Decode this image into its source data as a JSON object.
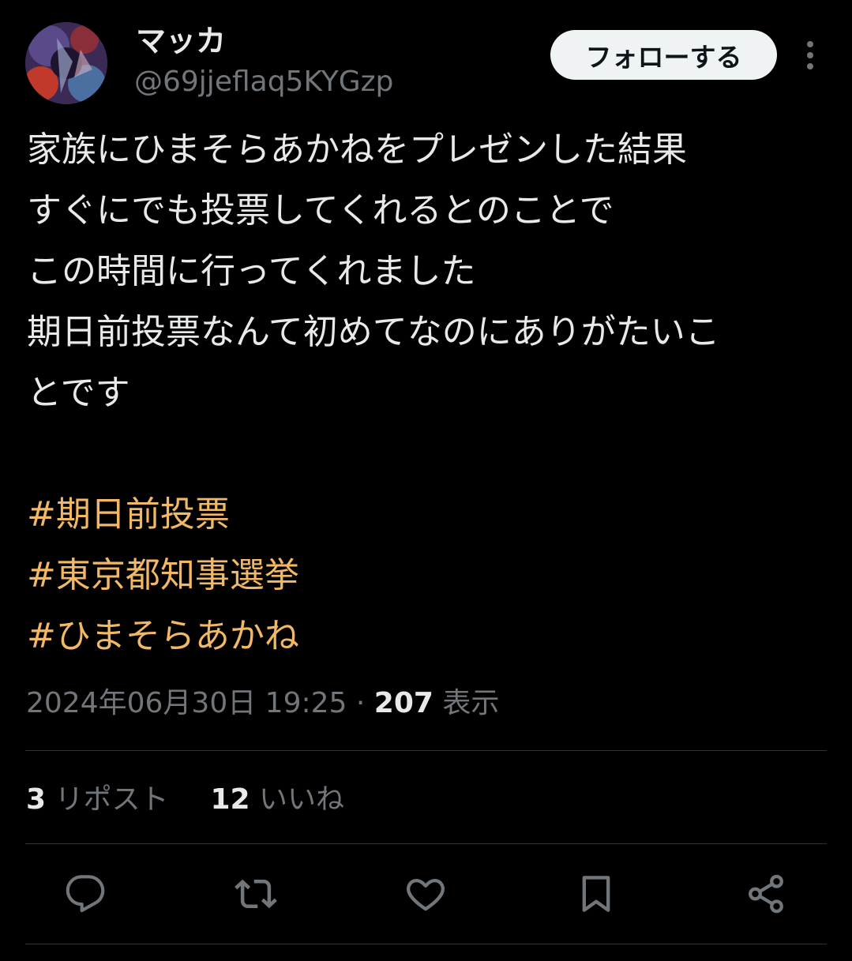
{
  "author": {
    "display_name": "マッカ",
    "handle": "@69jjeflaq5KYGzp"
  },
  "follow_button": {
    "label": "フォローする"
  },
  "more_button": {
    "icon": "more-vertical-icon"
  },
  "tweet": {
    "lines": [
      "家族にひまそらあかねをプレゼンした結果",
      "すぐにでも投票してくれるとのことで",
      "この時間に行ってくれました",
      "期日前投票なんて初めてなのにありがたいこ",
      "とです"
    ],
    "hashtags": [
      "#期日前投票",
      "#東京都知事選挙",
      "#ひまそらあかね"
    ]
  },
  "meta": {
    "timestamp": "2024年06月30日 19:25",
    "separator": " · ",
    "views_count": "207",
    "views_label": "表示"
  },
  "stats": {
    "reposts_count": "3",
    "reposts_label": "リポスト",
    "likes_count": "12",
    "likes_label": "いいね"
  },
  "actions": [
    {
      "name": "reply",
      "icon": "reply-icon"
    },
    {
      "name": "repost",
      "icon": "repost-icon"
    },
    {
      "name": "like",
      "icon": "heart-icon"
    },
    {
      "name": "bookmark",
      "icon": "bookmark-icon"
    },
    {
      "name": "share",
      "icon": "share-icon"
    }
  ],
  "colors": {
    "background": "#000000",
    "text_primary": "#e7e9ea",
    "text_secondary": "#71767b",
    "hashtag": "#f2b865",
    "divider": "#2f3336",
    "follow_button_bg": "#eff3f4"
  }
}
